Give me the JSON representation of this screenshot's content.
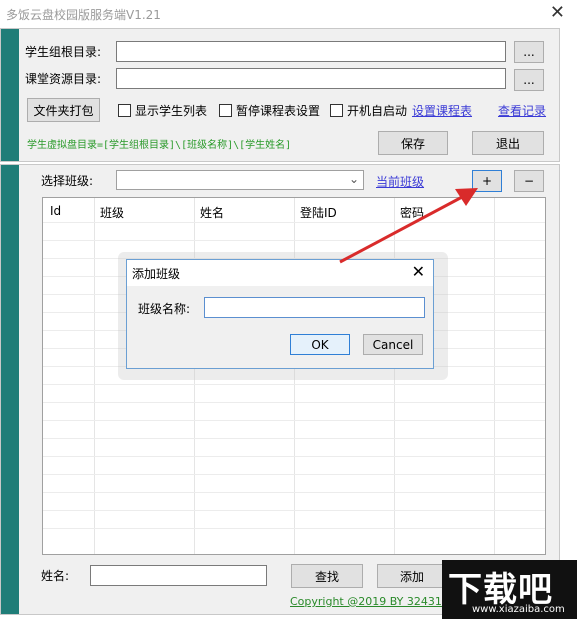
{
  "window": {
    "title": "多饭云盘校园版服务端V1.21",
    "close_glyph": "✕"
  },
  "settings": {
    "student_root_label": "学生组根目录:",
    "student_root_value": "",
    "course_res_label": "课堂资源目录:",
    "course_res_value": "",
    "browse_label": "...",
    "pack_button": "文件夹打包",
    "show_student_list": "显示学生列表",
    "pause_schedule": "暂停课程表设置",
    "autostart": "开机自启动",
    "set_schedule_link": "设置课程表",
    "view_log_link": "查看记录",
    "hint": "学生虚拟盘目录=[学生组根目录]\\[班级名称]\\[学生姓名]",
    "save_button": "保存",
    "exit_button": "退出"
  },
  "classes": {
    "select_label": "选择班级:",
    "select_value": "",
    "current_class_link": "当前班级",
    "add_button": "+",
    "remove_button": "−"
  },
  "table": {
    "columns": [
      "Id",
      "班级",
      "姓名",
      "登陆ID",
      "密码"
    ]
  },
  "footer": {
    "name_label": "姓名:",
    "name_value": "",
    "search_button": "查找",
    "add_button": "添加",
    "copyright": "Copyright @2019 BY 32431296"
  },
  "dialog": {
    "title": "添加班级",
    "close_glyph": "✕",
    "field_label": "班级名称:",
    "field_value": "",
    "ok_button": "OK",
    "cancel_button": "Cancel"
  },
  "watermark": {
    "big": "下载吧",
    "small": "www.xiazaiba.com"
  },
  "colors": {
    "teal": "#1f7d78",
    "link": "#3a3ad6",
    "hint": "#2a9a2a",
    "arrow": "#d92b2b"
  }
}
